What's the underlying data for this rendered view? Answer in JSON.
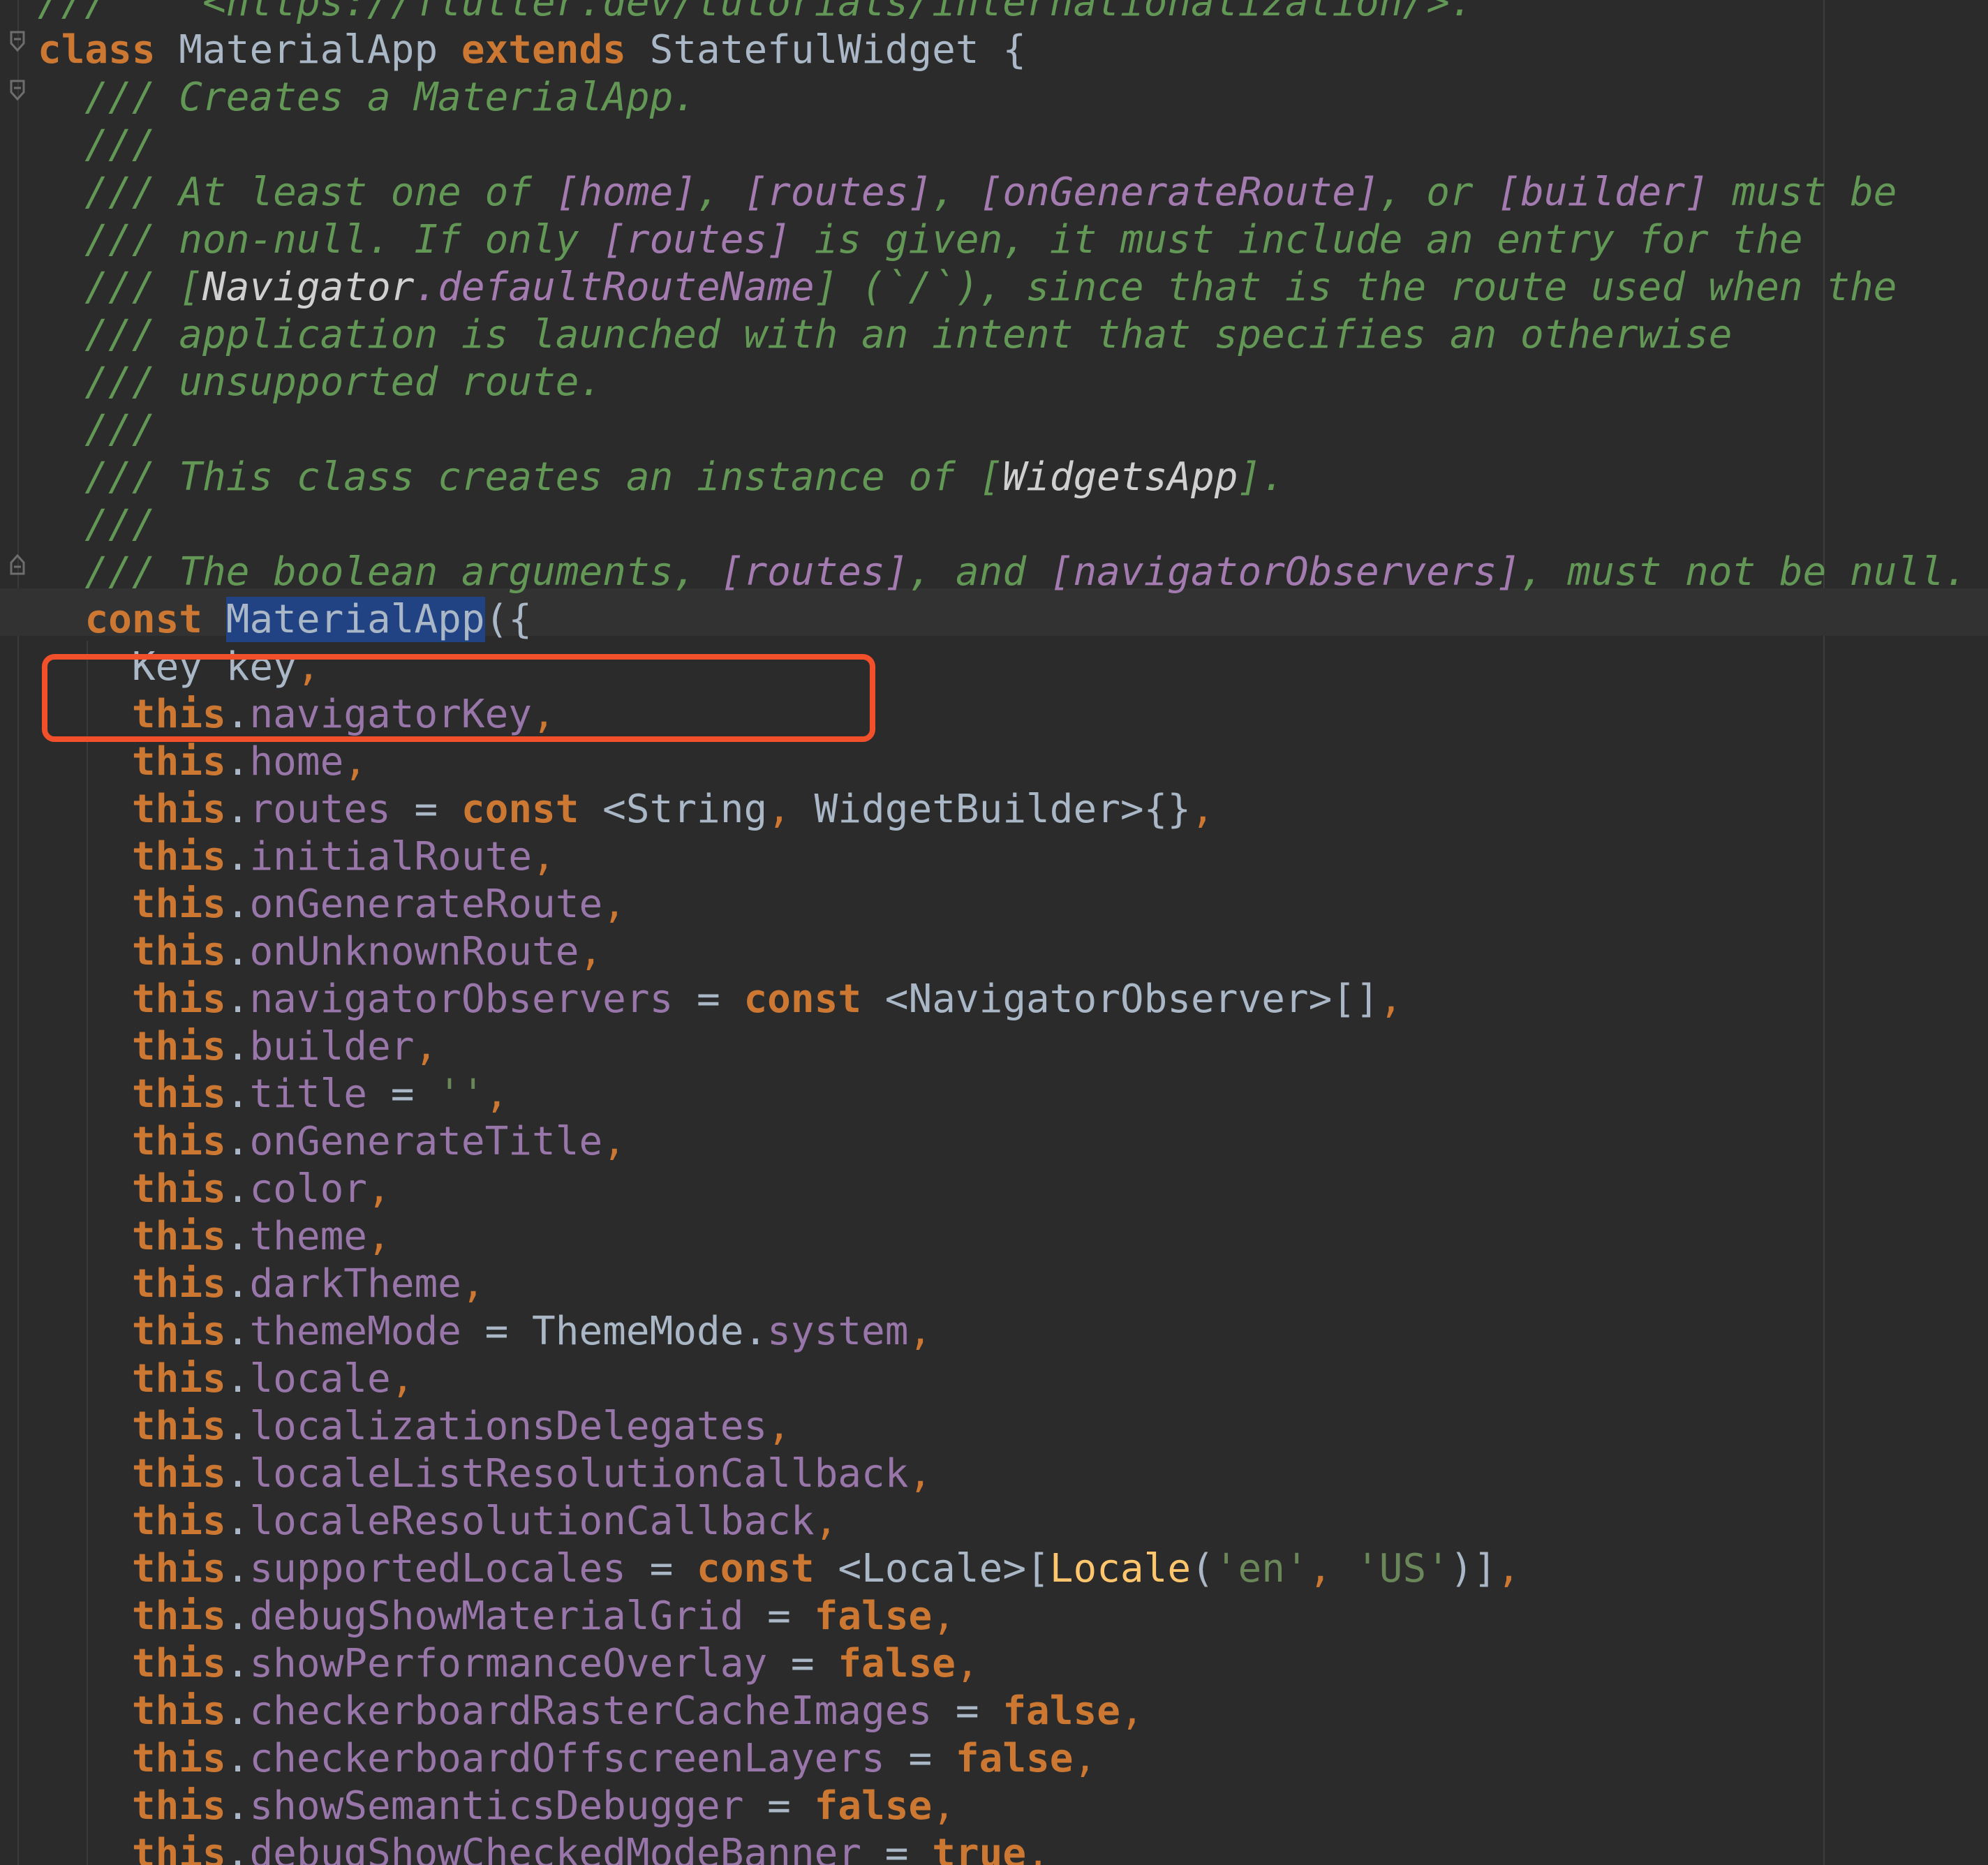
{
  "editor": {
    "lines": [
      [
        {
          "t": "///    <https://flutter.dev/tutorials/internationalization/>.",
          "c": "doc"
        }
      ],
      [
        {
          "t": "class",
          "c": "kw"
        },
        {
          "t": " MaterialApp ",
          "c": "cls"
        },
        {
          "t": "extends",
          "c": "kw"
        },
        {
          "t": " StatefulWidget {",
          "c": "cls"
        }
      ],
      [
        {
          "t": "  /// Creates a MaterialApp.",
          "c": "doc"
        }
      ],
      [
        {
          "t": "  ///",
          "c": "doc"
        }
      ],
      [
        {
          "t": "  /// At least one of ",
          "c": "doc"
        },
        {
          "t": "[home]",
          "c": "docref"
        },
        {
          "t": ", ",
          "c": "doc"
        },
        {
          "t": "[routes]",
          "c": "docref"
        },
        {
          "t": ", ",
          "c": "doc"
        },
        {
          "t": "[onGenerateRoute]",
          "c": "docref"
        },
        {
          "t": ", or ",
          "c": "doc"
        },
        {
          "t": "[builder]",
          "c": "docref"
        },
        {
          "t": " must be",
          "c": "doc"
        }
      ],
      [
        {
          "t": "  /// non-null. If only ",
          "c": "doc"
        },
        {
          "t": "[routes]",
          "c": "docref"
        },
        {
          "t": " is given, it must include an entry for the",
          "c": "doc"
        }
      ],
      [
        {
          "t": "  /// [",
          "c": "doc"
        },
        {
          "t": "Navigator",
          "c": "docid"
        },
        {
          "t": ".defaultRouteName",
          "c": "docref"
        },
        {
          "t": "] (`/`), since that is the route used when the",
          "c": "doc"
        }
      ],
      [
        {
          "t": "  /// application is launched with an intent that specifies an otherwise",
          "c": "doc"
        }
      ],
      [
        {
          "t": "  /// unsupported route.",
          "c": "doc"
        }
      ],
      [
        {
          "t": "  ///",
          "c": "doc"
        }
      ],
      [
        {
          "t": "  /// This class creates an instance of [",
          "c": "doc"
        },
        {
          "t": "WidgetsApp",
          "c": "docid"
        },
        {
          "t": "].",
          "c": "doc"
        }
      ],
      [
        {
          "t": "  ///",
          "c": "doc"
        }
      ],
      [
        {
          "t": "  /// The boolean arguments, ",
          "c": "doc"
        },
        {
          "t": "[routes]",
          "c": "docref"
        },
        {
          "t": ", and ",
          "c": "doc"
        },
        {
          "t": "[navigatorObservers]",
          "c": "docref"
        },
        {
          "t": ", must not be null.",
          "c": "doc"
        }
      ],
      [
        {
          "t": "  ",
          "c": "cls"
        },
        {
          "t": "const",
          "c": "kw"
        },
        {
          "t": " ",
          "c": "cls"
        },
        {
          "t": "MaterialApp",
          "c": "sel"
        },
        {
          "t": "({",
          "c": "cls"
        }
      ],
      [
        {
          "t": "    Key key",
          "c": "cls"
        },
        {
          "t": ",",
          "c": "punct"
        }
      ],
      [
        {
          "t": "    ",
          "c": "cls"
        },
        {
          "t": "this",
          "c": "kw"
        },
        {
          "t": ".",
          "c": "cls"
        },
        {
          "t": "navigatorKey",
          "c": "prop"
        },
        {
          "t": ",",
          "c": "punct"
        }
      ],
      [
        {
          "t": "    ",
          "c": "cls"
        },
        {
          "t": "this",
          "c": "kw"
        },
        {
          "t": ".",
          "c": "cls"
        },
        {
          "t": "home",
          "c": "prop"
        },
        {
          "t": ",",
          "c": "punct"
        }
      ],
      [
        {
          "t": "    ",
          "c": "cls"
        },
        {
          "t": "this",
          "c": "kw"
        },
        {
          "t": ".",
          "c": "cls"
        },
        {
          "t": "routes",
          "c": "prop"
        },
        {
          "t": " = ",
          "c": "cls"
        },
        {
          "t": "const",
          "c": "kw"
        },
        {
          "t": " <String",
          "c": "cls"
        },
        {
          "t": ",",
          "c": "punct"
        },
        {
          "t": " WidgetBuilder>{}",
          "c": "cls"
        },
        {
          "t": ",",
          "c": "punct"
        }
      ],
      [
        {
          "t": "    ",
          "c": "cls"
        },
        {
          "t": "this",
          "c": "kw"
        },
        {
          "t": ".",
          "c": "cls"
        },
        {
          "t": "initialRoute",
          "c": "prop"
        },
        {
          "t": ",",
          "c": "punct"
        }
      ],
      [
        {
          "t": "    ",
          "c": "cls"
        },
        {
          "t": "this",
          "c": "kw"
        },
        {
          "t": ".",
          "c": "cls"
        },
        {
          "t": "onGenerateRoute",
          "c": "prop"
        },
        {
          "t": ",",
          "c": "punct"
        }
      ],
      [
        {
          "t": "    ",
          "c": "cls"
        },
        {
          "t": "this",
          "c": "kw"
        },
        {
          "t": ".",
          "c": "cls"
        },
        {
          "t": "onUnknownRoute",
          "c": "prop"
        },
        {
          "t": ",",
          "c": "punct"
        }
      ],
      [
        {
          "t": "    ",
          "c": "cls"
        },
        {
          "t": "this",
          "c": "kw"
        },
        {
          "t": ".",
          "c": "cls"
        },
        {
          "t": "navigatorObservers",
          "c": "prop"
        },
        {
          "t": " = ",
          "c": "cls"
        },
        {
          "t": "const",
          "c": "kw"
        },
        {
          "t": " <NavigatorObserver>[]",
          "c": "cls"
        },
        {
          "t": ",",
          "c": "punct"
        }
      ],
      [
        {
          "t": "    ",
          "c": "cls"
        },
        {
          "t": "this",
          "c": "kw"
        },
        {
          "t": ".",
          "c": "cls"
        },
        {
          "t": "builder",
          "c": "prop"
        },
        {
          "t": ",",
          "c": "punct"
        }
      ],
      [
        {
          "t": "    ",
          "c": "cls"
        },
        {
          "t": "this",
          "c": "kw"
        },
        {
          "t": ".",
          "c": "cls"
        },
        {
          "t": "title",
          "c": "prop"
        },
        {
          "t": " = ",
          "c": "cls"
        },
        {
          "t": "''",
          "c": "str"
        },
        {
          "t": ",",
          "c": "punct"
        }
      ],
      [
        {
          "t": "    ",
          "c": "cls"
        },
        {
          "t": "this",
          "c": "kw"
        },
        {
          "t": ".",
          "c": "cls"
        },
        {
          "t": "onGenerateTitle",
          "c": "prop"
        },
        {
          "t": ",",
          "c": "punct"
        }
      ],
      [
        {
          "t": "    ",
          "c": "cls"
        },
        {
          "t": "this",
          "c": "kw"
        },
        {
          "t": ".",
          "c": "cls"
        },
        {
          "t": "color",
          "c": "prop"
        },
        {
          "t": ",",
          "c": "punct"
        }
      ],
      [
        {
          "t": "    ",
          "c": "cls"
        },
        {
          "t": "this",
          "c": "kw"
        },
        {
          "t": ".",
          "c": "cls"
        },
        {
          "t": "theme",
          "c": "prop"
        },
        {
          "t": ",",
          "c": "punct"
        }
      ],
      [
        {
          "t": "    ",
          "c": "cls"
        },
        {
          "t": "this",
          "c": "kw"
        },
        {
          "t": ".",
          "c": "cls"
        },
        {
          "t": "darkTheme",
          "c": "prop"
        },
        {
          "t": ",",
          "c": "punct"
        }
      ],
      [
        {
          "t": "    ",
          "c": "cls"
        },
        {
          "t": "this",
          "c": "kw"
        },
        {
          "t": ".",
          "c": "cls"
        },
        {
          "t": "themeMode",
          "c": "prop"
        },
        {
          "t": " = ThemeMode.",
          "c": "cls"
        },
        {
          "t": "system",
          "c": "prop"
        },
        {
          "t": ",",
          "c": "punct"
        }
      ],
      [
        {
          "t": "    ",
          "c": "cls"
        },
        {
          "t": "this",
          "c": "kw"
        },
        {
          "t": ".",
          "c": "cls"
        },
        {
          "t": "locale",
          "c": "prop"
        },
        {
          "t": ",",
          "c": "punct"
        }
      ],
      [
        {
          "t": "    ",
          "c": "cls"
        },
        {
          "t": "this",
          "c": "kw"
        },
        {
          "t": ".",
          "c": "cls"
        },
        {
          "t": "localizationsDelegates",
          "c": "prop"
        },
        {
          "t": ",",
          "c": "punct"
        }
      ],
      [
        {
          "t": "    ",
          "c": "cls"
        },
        {
          "t": "this",
          "c": "kw"
        },
        {
          "t": ".",
          "c": "cls"
        },
        {
          "t": "localeListResolutionCallback",
          "c": "prop"
        },
        {
          "t": ",",
          "c": "punct"
        }
      ],
      [
        {
          "t": "    ",
          "c": "cls"
        },
        {
          "t": "this",
          "c": "kw"
        },
        {
          "t": ".",
          "c": "cls"
        },
        {
          "t": "localeResolutionCallback",
          "c": "prop"
        },
        {
          "t": ",",
          "c": "punct"
        }
      ],
      [
        {
          "t": "    ",
          "c": "cls"
        },
        {
          "t": "this",
          "c": "kw"
        },
        {
          "t": ".",
          "c": "cls"
        },
        {
          "t": "supportedLocales",
          "c": "prop"
        },
        {
          "t": " = ",
          "c": "cls"
        },
        {
          "t": "const",
          "c": "kw"
        },
        {
          "t": " <Locale>[",
          "c": "cls"
        },
        {
          "t": "Locale",
          "c": "fn"
        },
        {
          "t": "(",
          "c": "cls"
        },
        {
          "t": "'en'",
          "c": "str"
        },
        {
          "t": ", ",
          "c": "punct"
        },
        {
          "t": "'US'",
          "c": "str"
        },
        {
          "t": ")]",
          "c": "cls"
        },
        {
          "t": ",",
          "c": "punct"
        }
      ],
      [
        {
          "t": "    ",
          "c": "cls"
        },
        {
          "t": "this",
          "c": "kw"
        },
        {
          "t": ".",
          "c": "cls"
        },
        {
          "t": "debugShowMaterialGrid",
          "c": "prop"
        },
        {
          "t": " = ",
          "c": "cls"
        },
        {
          "t": "false",
          "c": "kw"
        },
        {
          "t": ",",
          "c": "punct"
        }
      ],
      [
        {
          "t": "    ",
          "c": "cls"
        },
        {
          "t": "this",
          "c": "kw"
        },
        {
          "t": ".",
          "c": "cls"
        },
        {
          "t": "showPerformanceOverlay",
          "c": "prop"
        },
        {
          "t": " = ",
          "c": "cls"
        },
        {
          "t": "false",
          "c": "kw"
        },
        {
          "t": ",",
          "c": "punct"
        }
      ],
      [
        {
          "t": "    ",
          "c": "cls"
        },
        {
          "t": "this",
          "c": "kw"
        },
        {
          "t": ".",
          "c": "cls"
        },
        {
          "t": "checkerboardRasterCacheImages",
          "c": "prop"
        },
        {
          "t": " = ",
          "c": "cls"
        },
        {
          "t": "false",
          "c": "kw"
        },
        {
          "t": ",",
          "c": "punct"
        }
      ],
      [
        {
          "t": "    ",
          "c": "cls"
        },
        {
          "t": "this",
          "c": "kw"
        },
        {
          "t": ".",
          "c": "cls"
        },
        {
          "t": "checkerboardOffscreenLayers",
          "c": "prop"
        },
        {
          "t": " = ",
          "c": "cls"
        },
        {
          "t": "false",
          "c": "kw"
        },
        {
          "t": ",",
          "c": "punct"
        }
      ],
      [
        {
          "t": "    ",
          "c": "cls"
        },
        {
          "t": "this",
          "c": "kw"
        },
        {
          "t": ".",
          "c": "cls"
        },
        {
          "t": "showSemanticsDebugger",
          "c": "prop"
        },
        {
          "t": " = ",
          "c": "cls"
        },
        {
          "t": "false",
          "c": "kw"
        },
        {
          "t": ",",
          "c": "punct"
        }
      ],
      [
        {
          "t": "    ",
          "c": "cls"
        },
        {
          "t": "this",
          "c": "kw"
        },
        {
          "t": ".",
          "c": "cls"
        },
        {
          "t": "debugShowCheckedModeBanner",
          "c": "prop"
        },
        {
          "t": " = ",
          "c": "cls"
        },
        {
          "t": "true",
          "c": "kw"
        },
        {
          "t": ",",
          "c": "punct"
        }
      ]
    ],
    "fold_icon": "fold-toggle-icon",
    "highlight_color": "#f1502b",
    "selection_color": "#214283"
  }
}
